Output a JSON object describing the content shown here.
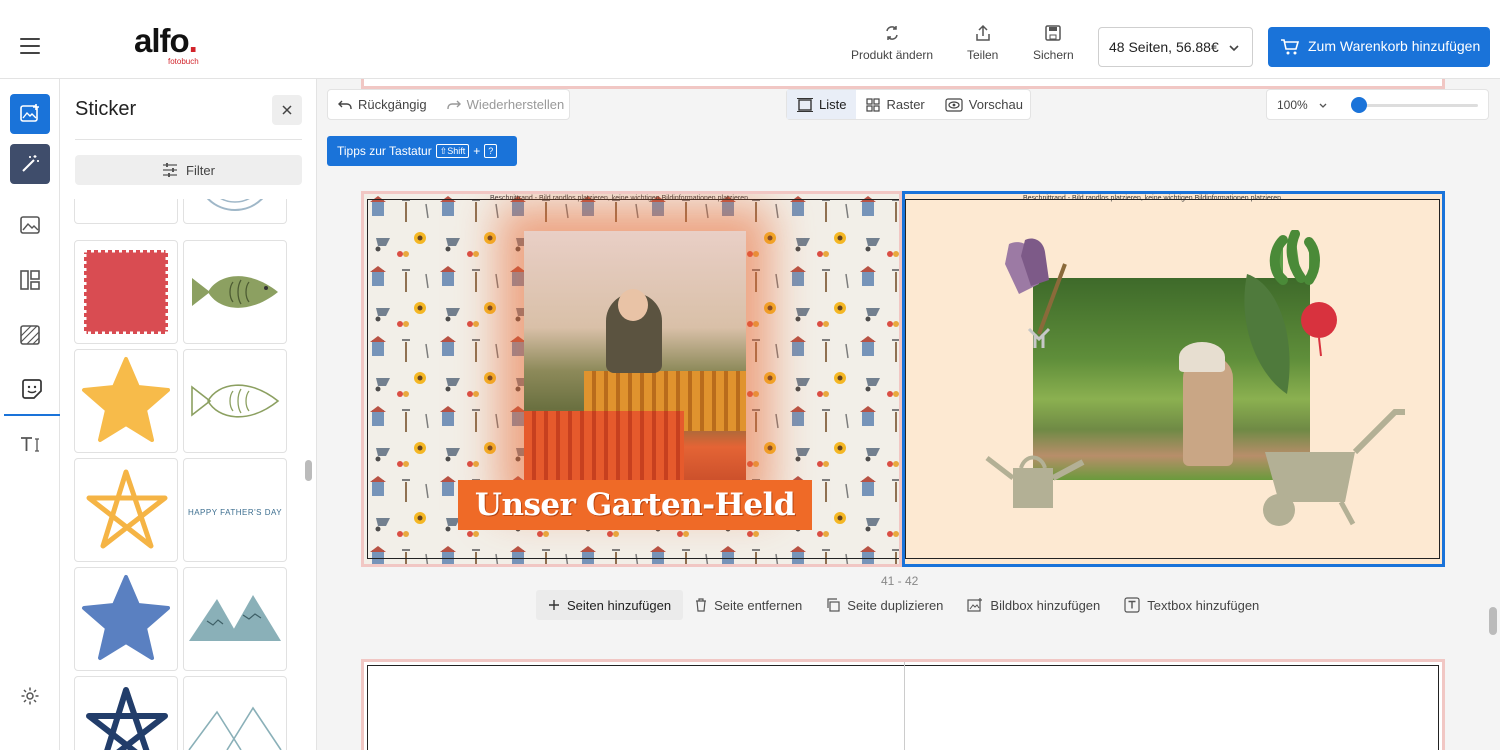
{
  "header": {
    "logo_text": "alfo",
    "logo_dot": ".",
    "logo_sub": "fotobuch",
    "actions": [
      {
        "label": "Produkt ändern",
        "icon": "refresh-icon"
      },
      {
        "label": "Teilen",
        "icon": "share-icon"
      },
      {
        "label": "Sichern",
        "icon": "save-icon"
      }
    ],
    "price_select": "48 Seiten, 56.88€",
    "cart_button": "Zum Warenkorb hinzufügen"
  },
  "rail": {
    "items": [
      "add-photo-icon",
      "magic-wand-icon",
      "image-icon",
      "layout-icon",
      "background-icon",
      "sticker-icon",
      "text-icon",
      "settings-icon"
    ]
  },
  "panel": {
    "title": "Sticker",
    "filter_label": "Filter"
  },
  "stickers": [
    {
      "name": "sticker-blue-stamp"
    },
    {
      "name": "sticker-circle-outline"
    },
    {
      "name": "sticker-red-stamp"
    },
    {
      "name": "sticker-green-fish"
    },
    {
      "name": "sticker-yellow-star"
    },
    {
      "name": "sticker-fish-outline"
    },
    {
      "name": "sticker-drawn-star"
    },
    {
      "name": "sticker-fathers-day",
      "text": "HAPPY FATHER'S DAY"
    },
    {
      "name": "sticker-blue-star"
    },
    {
      "name": "sticker-mountains"
    },
    {
      "name": "sticker-navy-star"
    },
    {
      "name": "sticker-mountains-outline"
    }
  ],
  "editor": {
    "undo": "Rückgängig",
    "redo": "Wiederherstellen",
    "view_list": "Liste",
    "view_grid": "Raster",
    "view_preview": "Vorschau",
    "tips_label": "Tipps zur Tastatur",
    "tips_shift": "⇧Shift",
    "tips_plus": "+",
    "tips_q": "?",
    "zoom": "100%",
    "zoom_level": 0,
    "bleed_left": "Beschnittrand - Bild randlos platzieren, keine wichtigen Bildinformationen platzieren",
    "bleed_right": "Beschnittrand - Bild randlos platzieren, keine wichtigen Bildinformationen platzieren",
    "title_text": "Unser Garten-Held",
    "page_number": "41 - 42",
    "page_actions": [
      "Seiten hinzufügen",
      "Seite entfernen",
      "Seite duplizieren",
      "Bildbox hinzufügen",
      "Textbox hinzufügen"
    ]
  },
  "colors": {
    "accent": "#1a73d9",
    "brand_red": "#d2232a",
    "title_banner": "#ef6a27",
    "right_page_bg": "#fde9d2"
  }
}
